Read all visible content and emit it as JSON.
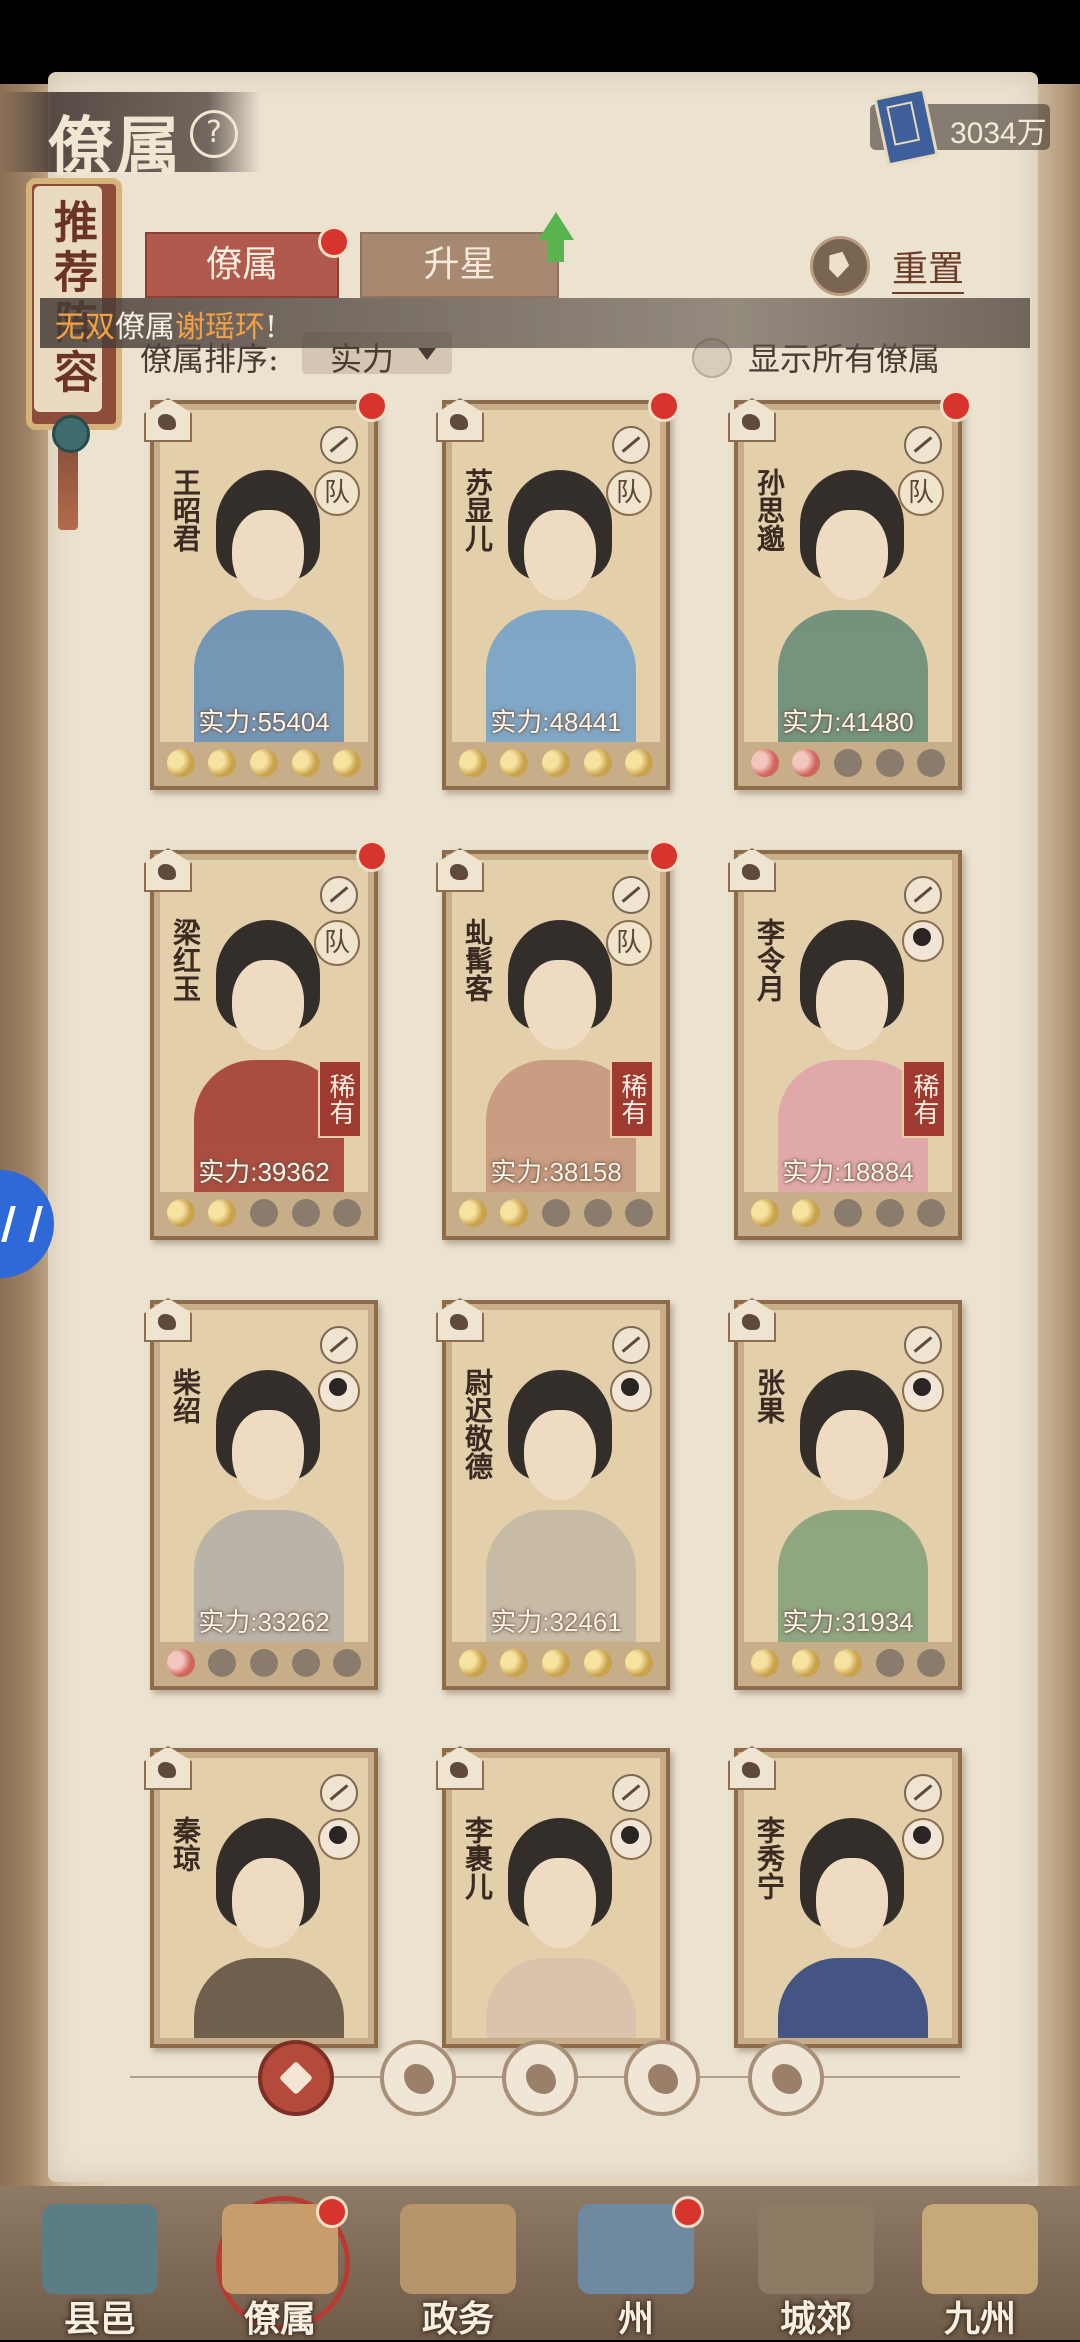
{
  "header": {
    "title": "僚属",
    "currency": "3034万"
  },
  "recommend": {
    "label": "推荐阵容"
  },
  "tabs": [
    {
      "label": "僚属"
    },
    {
      "label": "升星"
    }
  ],
  "reset": {
    "label": "重置"
  },
  "marquee": {
    "prefix": "无双",
    "middle": "僚属",
    "name": "谢瑶环",
    "suffix": "!"
  },
  "sort": {
    "label": "僚属排序:",
    "value": "实力"
  },
  "show_all": {
    "label": "显示所有僚属"
  },
  "power_prefix": "实力:",
  "cards": [
    {
      "name": "王昭君",
      "power": "55404",
      "stars": [
        "lit",
        "lit",
        "lit",
        "lit",
        "lit"
      ],
      "team": "队",
      "rare": "",
      "robe": "#6f93b6"
    },
    {
      "name": "苏显儿",
      "power": "48441",
      "stars": [
        "lit",
        "lit",
        "lit",
        "lit",
        "lit"
      ],
      "team": "队",
      "rare": "",
      "robe": "#7aa4c6"
    },
    {
      "name": "孙思邈",
      "power": "41480",
      "stars": [
        "red",
        "red",
        "dim",
        "dim",
        "dim"
      ],
      "team": "队",
      "rare": "",
      "robe": "#6f8f7a"
    },
    {
      "name": "梁红玉",
      "power": "39362",
      "stars": [
        "lit",
        "lit",
        "dim",
        "dim",
        "dim"
      ],
      "team": "队",
      "rare": "稀有",
      "robe": "#a8473b"
    },
    {
      "name": "虬髯客",
      "power": "38158",
      "stars": [
        "lit",
        "lit",
        "dim",
        "dim",
        "dim"
      ],
      "team": "队",
      "rare": "稀有",
      "robe": "#c79b7f"
    },
    {
      "name": "李令月",
      "power": "18884",
      "stars": [
        "lit",
        "lit",
        "dim",
        "dim",
        "dim"
      ],
      "team": "",
      "rare": "稀有",
      "robe": "#e0a6a8"
    },
    {
      "name": "柴绍",
      "power": "33262",
      "stars": [
        "red",
        "dim",
        "dim",
        "dim",
        "dim"
      ],
      "team": "",
      "rare": "",
      "robe": "#b7b1a6"
    },
    {
      "name": "尉迟敬德",
      "power": "32461",
      "stars": [
        "lit",
        "lit",
        "lit",
        "lit",
        "lit"
      ],
      "team": "",
      "rare": "",
      "robe": "#c6b9a4"
    },
    {
      "name": "张果",
      "power": "31934",
      "stars": [
        "lit",
        "lit",
        "lit",
        "dim",
        "dim"
      ],
      "team": "",
      "rare": "",
      "robe": "#8aa37e"
    },
    {
      "name": "秦琼",
      "power": "",
      "stars": [],
      "team": "",
      "rare": "",
      "robe": "#6b5a4a"
    },
    {
      "name": "李裹儿",
      "power": "",
      "stars": [],
      "team": "",
      "rare": "",
      "robe": "#d9c3ae"
    },
    {
      "name": "李秀宁",
      "power": "",
      "stars": [],
      "team": "",
      "rare": "",
      "robe": "#3d4f82"
    }
  ],
  "bottom_nav": [
    {
      "label": "县邑",
      "color": "#5b7d86"
    },
    {
      "label": "僚属",
      "color": "#c79d6c"
    },
    {
      "label": "政务",
      "color": "#b7946b"
    },
    {
      "label": "州",
      "color": "#6f8aa0"
    },
    {
      "label": "城郊",
      "color": "#8e7a62"
    },
    {
      "label": "九州",
      "color": "#c7a879"
    }
  ]
}
